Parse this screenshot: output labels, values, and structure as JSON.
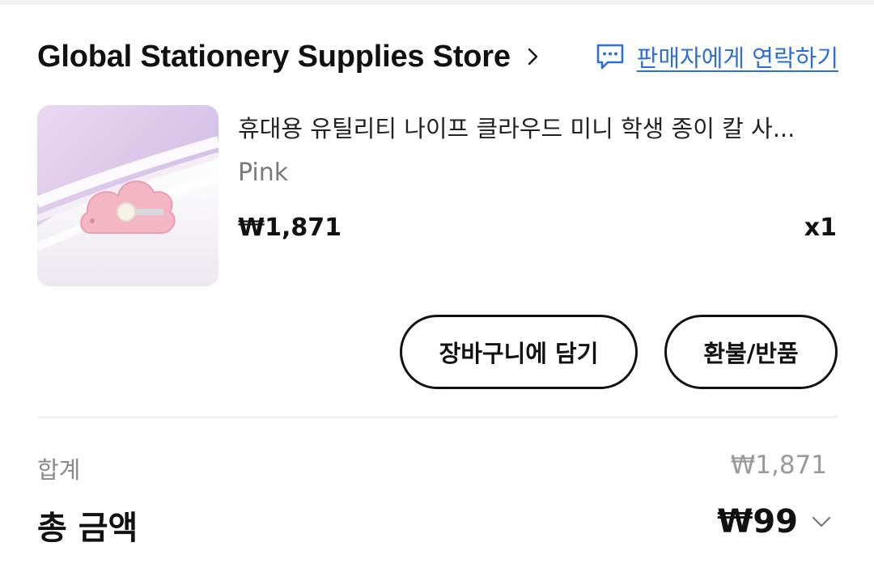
{
  "store": {
    "name": "Global Stationery Supplies Store",
    "contact_label": "판매자에게 연락하기"
  },
  "product": {
    "title": "휴대용 유틸리티 나이프 클라우드 미니 학생 종이 칼 사...",
    "variant": "Pink",
    "price": "₩1,871",
    "quantity": "x1",
    "image_icon": "pink-cloud-knife-photo"
  },
  "actions": {
    "add_to_cart": "장바구니에 담기",
    "refund_return": "환불/반품"
  },
  "summary": {
    "subtotal_label": "합계",
    "subtotal_value": "₩1,871",
    "total_label": "총 금액",
    "total_value": "₩99"
  },
  "colors": {
    "link_blue": "#2d6fd6",
    "text_primary": "#111111",
    "text_muted": "#8a8a8a"
  }
}
